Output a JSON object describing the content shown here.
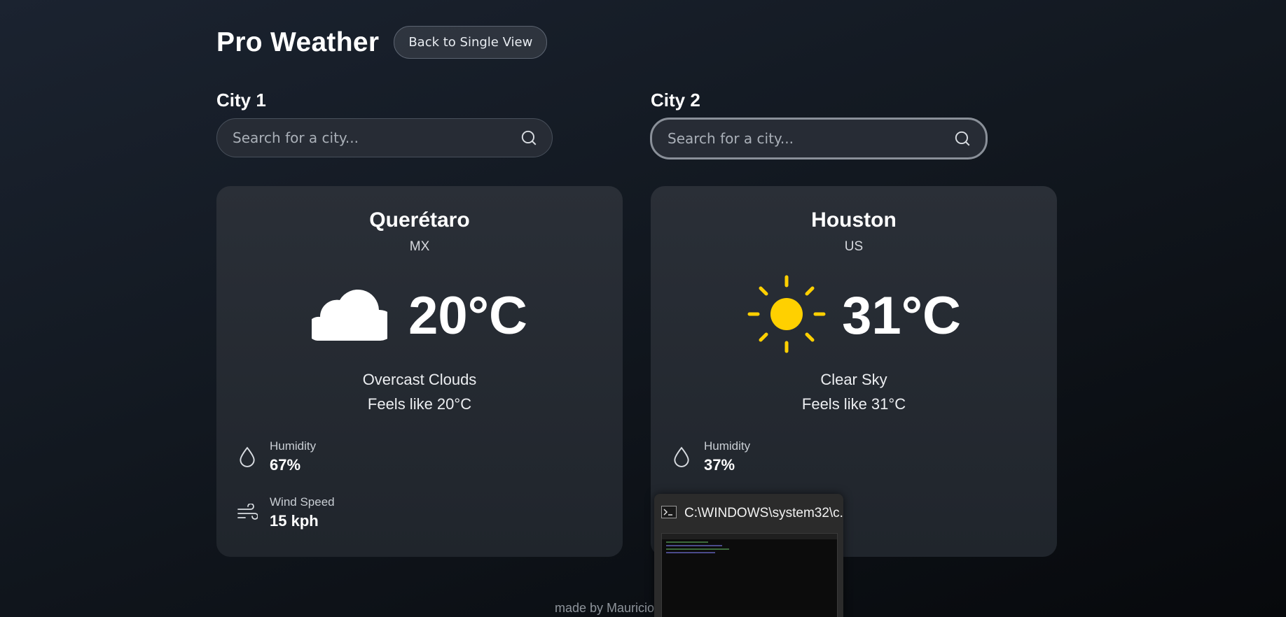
{
  "app": {
    "title": "Pro Weather",
    "back_label": "Back to Single View"
  },
  "cities": [
    {
      "label": "City 1",
      "search_placeholder": "Search for a city...",
      "name": "Querétaro",
      "country": "MX",
      "icon": "cloud-icon",
      "temperature": "20°C",
      "description": "Overcast Clouds",
      "feels_like": "Feels like 20°C",
      "humidity_label": "Humidity",
      "humidity": "67%",
      "wind_label": "Wind Speed",
      "wind": "15 kph"
    },
    {
      "label": "City 2",
      "search_placeholder": "Search for a city...",
      "name": "Houston",
      "country": "US",
      "icon": "sun-icon",
      "temperature": "31°C",
      "description": "Clear Sky",
      "feels_like": "Feels like 31°C",
      "humidity_label": "Humidity",
      "humidity": "37%"
    }
  ],
  "footer": {
    "text": "made by Mauricio"
  },
  "taskbar_preview": {
    "title": "C:\\WINDOWS\\system32\\c...",
    "icon": "terminal-icon"
  },
  "colors": {
    "sun": "#ffd000",
    "background": "#151b23",
    "card": "#262b33"
  }
}
